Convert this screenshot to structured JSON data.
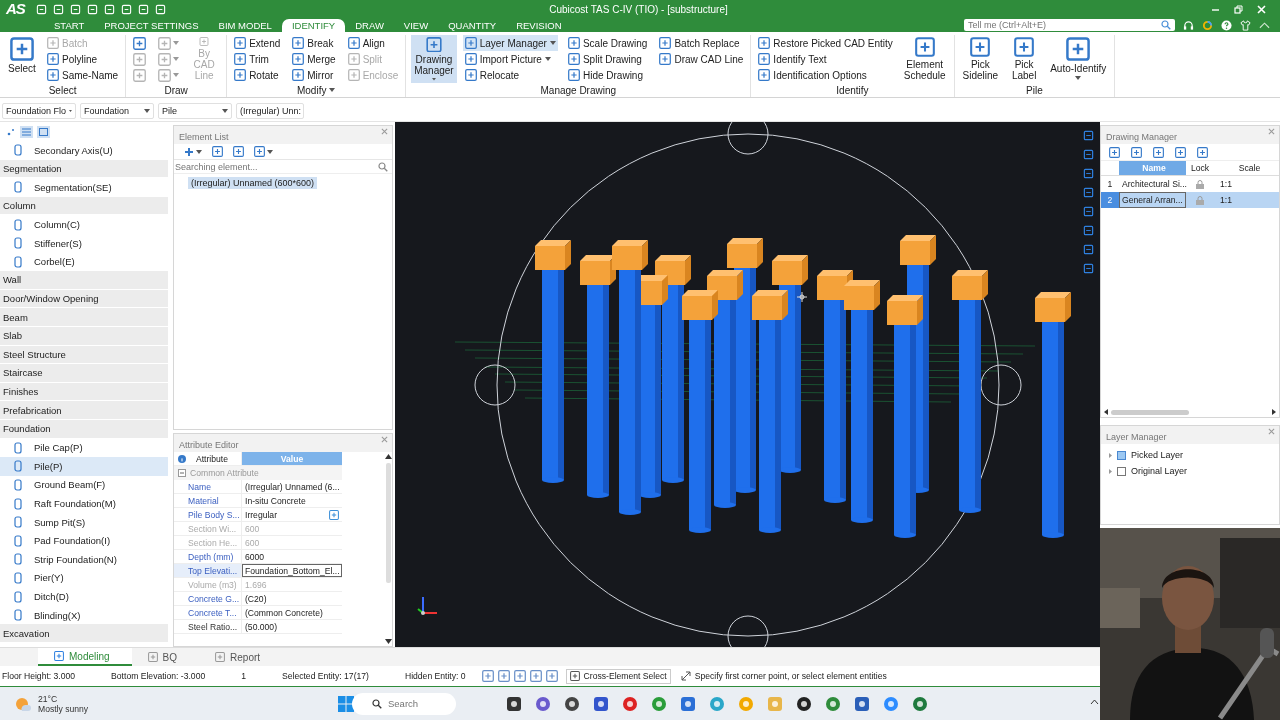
{
  "title_bar": {
    "logo": "AS",
    "title": "Cubicost TAS C-IV (TIO) - [substructure]",
    "search_placeholder": "Tell me (Ctrl+Alt+E)"
  },
  "ribbon_tabs": [
    {
      "label": "START",
      "selected": false
    },
    {
      "label": "PROJECT SETTINGS",
      "selected": false
    },
    {
      "label": "BIM MODEL",
      "selected": false
    },
    {
      "label": "IDENTIFY",
      "selected": true
    },
    {
      "label": "DRAW",
      "selected": false
    },
    {
      "label": "VIEW",
      "selected": false
    },
    {
      "label": "QUANTITY",
      "selected": false
    },
    {
      "label": "REVISION",
      "selected": false
    }
  ],
  "ribbon_groups": [
    {
      "title": "Select",
      "menu": false,
      "items": [
        {
          "kind": "large",
          "label": "Select",
          "disabled": false,
          "active": false,
          "menu": false
        },
        {
          "kind": "small",
          "label": "Batch",
          "disabled": true,
          "active": false,
          "menu": false
        },
        {
          "kind": "small",
          "label": "Polyline",
          "disabled": false,
          "active": false,
          "menu": false
        },
        {
          "kind": "small",
          "label": "Same-Name",
          "disabled": false,
          "active": false,
          "menu": false
        }
      ]
    },
    {
      "title": "Draw",
      "menu": false,
      "items": [
        {
          "kind": "icon",
          "disabled": false,
          "active": false,
          "menu": false
        },
        {
          "kind": "icon",
          "disabled": true,
          "active": false,
          "menu": false
        },
        {
          "kind": "icon",
          "disabled": true,
          "active": false,
          "menu": false
        },
        {
          "kind": "icon",
          "disabled": true,
          "active": false,
          "menu": true
        },
        {
          "kind": "icon",
          "disabled": true,
          "active": false,
          "menu": true
        },
        {
          "kind": "icon",
          "disabled": true,
          "active": false,
          "menu": true
        },
        {
          "kind": "large",
          "label": "By CAD Line",
          "disabled": true,
          "active": false,
          "menu": false
        }
      ]
    },
    {
      "title": "Modify",
      "menu": true,
      "items": [
        {
          "kind": "small",
          "label": "Extend",
          "disabled": false,
          "active": false,
          "menu": false
        },
        {
          "kind": "small",
          "label": "Trim",
          "disabled": false,
          "active": false,
          "menu": false
        },
        {
          "kind": "small",
          "label": "Rotate",
          "disabled": false,
          "active": false,
          "menu": false
        },
        {
          "kind": "small",
          "label": "Break",
          "disabled": false,
          "active": false,
          "menu": false
        },
        {
          "kind": "small",
          "label": "Merge",
          "disabled": false,
          "active": false,
          "menu": false
        },
        {
          "kind": "small",
          "label": "Mirror",
          "disabled": false,
          "active": false,
          "menu": false
        },
        {
          "kind": "small",
          "label": "Align",
          "disabled": false,
          "active": false,
          "menu": false
        },
        {
          "kind": "small",
          "label": "Split",
          "disabled": true,
          "active": false,
          "menu": false
        },
        {
          "kind": "small",
          "label": "Enclose",
          "disabled": true,
          "active": false,
          "menu": false
        }
      ]
    },
    {
      "title": "Manage Drawing",
      "menu": false,
      "items": [
        {
          "kind": "large",
          "label": "Drawing Manager",
          "disabled": false,
          "active": true,
          "menu": true
        },
        {
          "kind": "small",
          "label": "Layer Manager",
          "disabled": false,
          "active": true,
          "menu": true
        },
        {
          "kind": "small",
          "label": "Import Picture",
          "disabled": false,
          "active": false,
          "menu": true
        },
        {
          "kind": "small",
          "label": "Relocate",
          "disabled": false,
          "active": false,
          "menu": false
        },
        {
          "kind": "small",
          "label": "Scale Drawing",
          "disabled": false,
          "active": false,
          "menu": false
        },
        {
          "kind": "small",
          "label": "Split Drawing",
          "disabled": false,
          "active": false,
          "menu": false
        },
        {
          "kind": "small",
          "label": "Hide Drawing",
          "disabled": false,
          "active": false,
          "menu": false
        },
        {
          "kind": "small",
          "label": "Batch Replace",
          "disabled": false,
          "active": false,
          "menu": false
        },
        {
          "kind": "small",
          "label": "Draw CAD Line",
          "disabled": false,
          "active": false,
          "menu": false
        }
      ]
    },
    {
      "title": "Identify",
      "menu": false,
      "items": [
        {
          "kind": "small",
          "label": "Restore Picked CAD Entity",
          "disabled": false,
          "active": false,
          "menu": false
        },
        {
          "kind": "small",
          "label": "Identify Text",
          "disabled": false,
          "active": false,
          "menu": false
        },
        {
          "kind": "small",
          "label": "Identification Options",
          "disabled": false,
          "active": false,
          "menu": false
        },
        {
          "kind": "large",
          "label": "Element Schedule",
          "disabled": false,
          "active": false,
          "menu": false
        }
      ]
    },
    {
      "title": "Pile",
      "menu": false,
      "items": [
        {
          "kind": "large",
          "label": "Pick Sideline",
          "disabled": false,
          "active": false,
          "menu": false
        },
        {
          "kind": "large",
          "label": "Pick Label",
          "disabled": false,
          "active": false,
          "menu": false
        },
        {
          "kind": "large",
          "label": "Auto-Identify",
          "disabled": false,
          "active": false,
          "menu": true
        }
      ]
    }
  ],
  "selectors": [
    "Foundation Flo",
    "Foundation",
    "Pile",
    "(Irregular) Unn:"
  ],
  "nav": [
    {
      "kind": "item",
      "label": "Secondary Axis(U)",
      "selected": false
    },
    {
      "kind": "header",
      "label": "Segmentation"
    },
    {
      "kind": "item",
      "label": "Segmentation(SE)",
      "selected": false
    },
    {
      "kind": "header",
      "label": "Column"
    },
    {
      "kind": "item",
      "label": "Column(C)",
      "selected": false
    },
    {
      "kind": "item",
      "label": "Stiffener(S)",
      "selected": false
    },
    {
      "kind": "item",
      "label": "Corbel(E)",
      "selected": false
    },
    {
      "kind": "header",
      "label": "Wall"
    },
    {
      "kind": "header",
      "label": "Door/Window Opening"
    },
    {
      "kind": "header",
      "label": "Beam"
    },
    {
      "kind": "header",
      "label": "Slab"
    },
    {
      "kind": "header",
      "label": "Steel Structure"
    },
    {
      "kind": "header",
      "label": "Staircase"
    },
    {
      "kind": "header",
      "label": "Finishes"
    },
    {
      "kind": "header",
      "label": "Prefabrication"
    },
    {
      "kind": "header",
      "label": "Foundation"
    },
    {
      "kind": "item",
      "label": "Pile Cap(P)",
      "selected": false
    },
    {
      "kind": "item",
      "label": "Pile(P)",
      "selected": true
    },
    {
      "kind": "item",
      "label": "Ground Beam(F)",
      "selected": false
    },
    {
      "kind": "item",
      "label": "Raft Foundation(M)",
      "selected": false
    },
    {
      "kind": "item",
      "label": "Sump Pit(S)",
      "selected": false
    },
    {
      "kind": "item",
      "label": "Pad Foundation(I)",
      "selected": false
    },
    {
      "kind": "item",
      "label": "Strip Foundation(N)",
      "selected": false
    },
    {
      "kind": "item",
      "label": "Pier(Y)",
      "selected": false
    },
    {
      "kind": "item",
      "label": "Ditch(D)",
      "selected": false
    },
    {
      "kind": "item",
      "label": "Blinding(X)",
      "selected": false
    },
    {
      "kind": "header",
      "label": "Excavation"
    }
  ],
  "element_list": {
    "title": "Element List",
    "search_placeholder": "Searching element...",
    "items": [
      {
        "label": "(Irregular) Unnamed (600*600)",
        "selected": true
      }
    ]
  },
  "attribute_editor": {
    "title": "Attribute Editor",
    "columns": [
      "Attribute",
      "Value"
    ],
    "group": {
      "label": "Common Attribute",
      "expanded": true
    },
    "rows": [
      {
        "kind": "text",
        "name": "Name",
        "value": "(Irregular) Unnamed (6...",
        "editable": true,
        "readonly": false,
        "selected": false
      },
      {
        "kind": "text",
        "name": "Material",
        "value": "In-situ Concrete",
        "editable": true,
        "readonly": false,
        "selected": false
      },
      {
        "kind": "picker",
        "name": "Pile Body S...",
        "value": "Irregular",
        "editable": true,
        "readonly": false,
        "selected": false
      },
      {
        "kind": "text",
        "name": "Section Wi...",
        "value": "600",
        "editable": false,
        "readonly": true,
        "selected": false
      },
      {
        "kind": "text",
        "name": "Section He...",
        "value": "600",
        "editable": false,
        "readonly": true,
        "selected": false
      },
      {
        "kind": "text",
        "name": "Depth (mm)",
        "value": "6000",
        "editable": true,
        "readonly": false,
        "selected": false
      },
      {
        "kind": "text",
        "name": "Top Elevati...",
        "value": "Foundation_Bottom_El...",
        "editable": true,
        "readonly": false,
        "selected": true
      },
      {
        "kind": "text",
        "name": "Volume (m3)",
        "value": "1.696",
        "editable": false,
        "readonly": true,
        "selected": false
      },
      {
        "kind": "text",
        "name": "Concrete G...",
        "value": "(C20)",
        "editable": true,
        "readonly": false,
        "selected": false
      },
      {
        "kind": "text",
        "name": "Concrete T...",
        "value": "(Common Concrete)",
        "editable": true,
        "readonly": false,
        "selected": false
      },
      {
        "kind": "text",
        "name": "Steel Ratio...",
        "value": "(50.000)",
        "editable": false,
        "readonly": false,
        "selected": false
      }
    ]
  },
  "drawing_manager": {
    "title": "Drawing Manager",
    "columns": [
      "Name",
      "Lock",
      "Scale"
    ],
    "rows": [
      {
        "index": "1",
        "name": "Architectural Si...",
        "locked": true,
        "scale": "1:1",
        "selected": false
      },
      {
        "index": "2",
        "name": "General Arran...",
        "locked": true,
        "scale": "1:1",
        "selected": true
      }
    ]
  },
  "layer_manager": {
    "title": "Layer Manager",
    "items": [
      {
        "label": "Picked Layer",
        "checked": true
      },
      {
        "label": "Original Layer",
        "checked": false
      }
    ]
  },
  "bottom_tabs": [
    {
      "label": "Modeling",
      "selected": true
    },
    {
      "label": "BQ",
      "selected": false
    },
    {
      "label": "Report",
      "selected": false
    }
  ],
  "status_bar": {
    "items": [
      "Floor Height: 3.000",
      "Bottom Elevation: -3.000",
      "1",
      "Selected Entity: 17(17)",
      "Hidden Entity: 0"
    ],
    "button": "Cross-Element Select",
    "prompt": "Specify first corner point, or select element entities"
  },
  "taskbar": {
    "temperature": "21°C",
    "condition": "Mostly sunny",
    "search_placeholder": "Search"
  },
  "webcam": {
    "kind": "picture"
  }
}
